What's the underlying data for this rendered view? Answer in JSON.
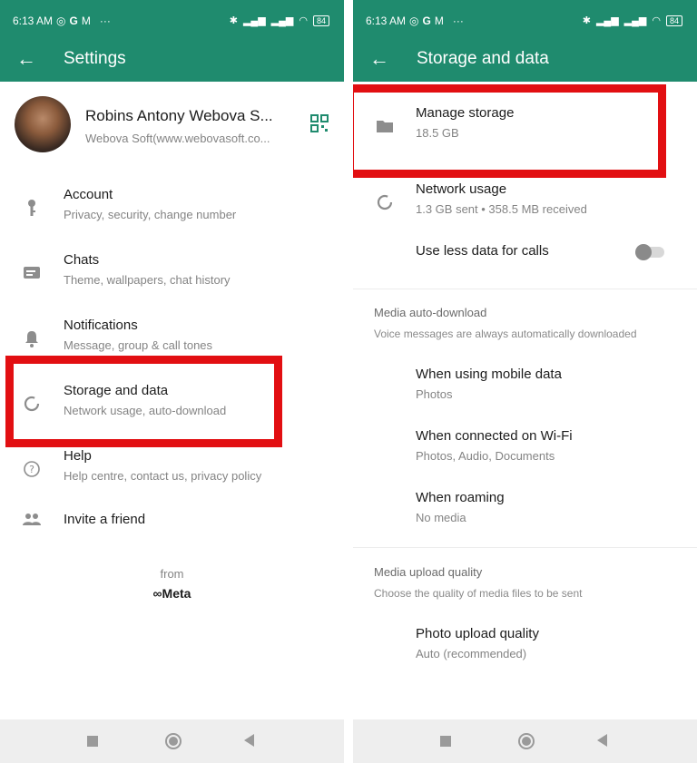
{
  "status": {
    "time": "6:13 AM",
    "more": "···",
    "battery": "84"
  },
  "left": {
    "title": "Settings",
    "profile": {
      "name": "Robins Antony Webova S...",
      "subtitle": "Webova Soft(www.webovasoft.co..."
    },
    "items": [
      {
        "title": "Account",
        "subtitle": "Privacy, security, change number"
      },
      {
        "title": "Chats",
        "subtitle": "Theme, wallpapers, chat history"
      },
      {
        "title": "Notifications",
        "subtitle": "Message, group & call tones"
      },
      {
        "title": "Storage and data",
        "subtitle": "Network usage, auto-download"
      },
      {
        "title": "Help",
        "subtitle": "Help centre, contact us, privacy policy"
      },
      {
        "title": "Invite a friend",
        "subtitle": ""
      }
    ],
    "footer": {
      "from": "from",
      "brand": "∞Meta"
    }
  },
  "right": {
    "title": "Storage and data",
    "manage": {
      "title": "Manage storage",
      "subtitle": "18.5 GB"
    },
    "network": {
      "title": "Network usage",
      "subtitle": "1.3 GB sent • 358.5 MB received"
    },
    "less_data": {
      "title": "Use less data for calls",
      "toggle_on": false
    },
    "media_auto": {
      "header": "Media auto-download",
      "subheader": "Voice messages are always automatically downloaded",
      "items": [
        {
          "title": "When using mobile data",
          "subtitle": "Photos"
        },
        {
          "title": "When connected on Wi-Fi",
          "subtitle": "Photos, Audio, Documents"
        },
        {
          "title": "When roaming",
          "subtitle": "No media"
        }
      ]
    },
    "upload": {
      "header": "Media upload quality",
      "subheader": "Choose the quality of media files to be sent",
      "item": {
        "title": "Photo upload quality",
        "subtitle": "Auto (recommended)"
      }
    }
  },
  "colors": {
    "header": "#1f8b6e",
    "highlight": "#e20f12",
    "accent": "#1f8b6e"
  }
}
